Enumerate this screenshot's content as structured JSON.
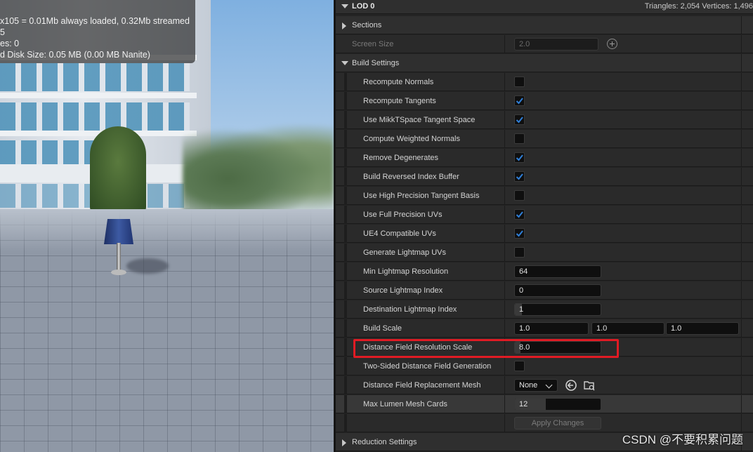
{
  "viewport": {
    "stats_lines": [
      "x105 = 0.01Mb always loaded, 0.32Mb streamed",
      "5",
      "es:  0",
      "d Disk Size: 0.05 MB (0.00 MB Nanite)"
    ]
  },
  "panel": {
    "lod": {
      "label": "LOD 0",
      "stats": "Triangles: 2,054   Vertices: 1,496"
    },
    "sections": {
      "label": "Sections"
    },
    "screen_size": {
      "label": "Screen Size",
      "value": "2.0"
    },
    "build_settings": {
      "label": "Build Settings",
      "checkboxes": [
        {
          "label": "Recompute Normals",
          "checked": false
        },
        {
          "label": "Recompute Tangents",
          "checked": true
        },
        {
          "label": "Use MikkTSpace Tangent Space",
          "checked": true
        },
        {
          "label": "Compute Weighted Normals",
          "checked": false
        },
        {
          "label": "Remove Degenerates",
          "checked": true
        },
        {
          "label": "Build Reversed Index Buffer",
          "checked": true
        },
        {
          "label": "Use High Precision Tangent Basis",
          "checked": false
        },
        {
          "label": "Use Full Precision UVs",
          "checked": true
        },
        {
          "label": "UE4 Compatible UVs",
          "checked": true
        },
        {
          "label": "Generate Lightmap UVs",
          "checked": false
        }
      ],
      "min_lightmap_resolution": {
        "label": "Min Lightmap Resolution",
        "value": "64"
      },
      "source_lightmap_index": {
        "label": "Source Lightmap Index",
        "value": "0"
      },
      "destination_lightmap_index": {
        "label": "Destination Lightmap Index",
        "value": "1"
      },
      "build_scale": {
        "label": "Build Scale",
        "x": "1.0",
        "y": "1.0",
        "z": "1.0"
      },
      "distance_field_resolution_scale": {
        "label": "Distance Field Resolution Scale",
        "value": "8.0"
      },
      "two_sided_distance_field": {
        "label": "Two-Sided Distance Field Generation",
        "checked": false
      },
      "distance_field_replacement_mesh": {
        "label": "Distance Field Replacement Mesh",
        "value": "None"
      },
      "max_lumen_mesh_cards": {
        "label": "Max Lumen Mesh Cards",
        "value": "12"
      },
      "apply_changes": "Apply Changes"
    },
    "reduction_settings": {
      "label": "Reduction Settings"
    }
  },
  "watermark": "CSDN @不要积累问题",
  "colors": {
    "accent_check": "#2f7fd8",
    "highlight_box": "#e01b24",
    "panel_bg": "#242424"
  }
}
